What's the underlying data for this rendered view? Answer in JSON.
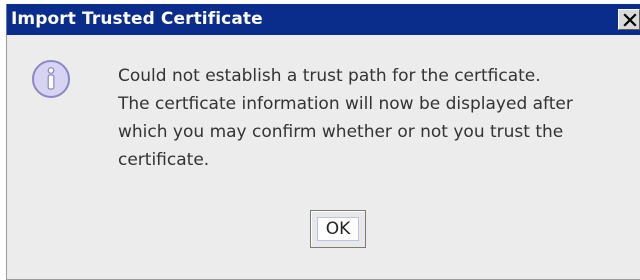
{
  "dialog": {
    "title": "Import Trusted Certificate",
    "message_lines": [
      "Could not establish a trust path for the certficate.",
      "The certficate information will now be displayed after",
      "which you may confirm whether or not you trust the",
      "certificate."
    ],
    "ok_label": "OK"
  },
  "icons": {
    "message_icon": "info-icon",
    "close_icon": "close-icon"
  },
  "colors": {
    "titlebar": "#0a2d8c",
    "panel": "#ececec",
    "icon_fill": "#d7d3f3",
    "icon_stroke": "#8e86c7"
  }
}
